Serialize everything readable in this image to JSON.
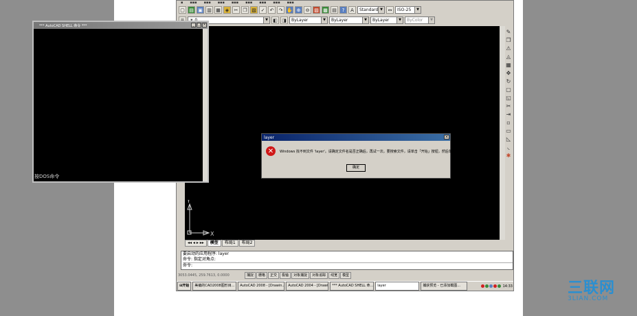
{
  "toolbar": {
    "textstyle": "Standard",
    "dimstyle": "ISO-25",
    "layer": "0",
    "color": "ByLayer",
    "linetype": "ByLayer",
    "lineweight": "ByLayer",
    "plotstyle": "ByColor"
  },
  "shell_window": {
    "title": "*** AutoCAD SHELL 命令 ***",
    "prompt": "按DOS命令"
  },
  "dialog": {
    "title": "layer",
    "message": "Windows 找不到文件 'layer'。请确定文件名是否正确后，再试一次。要搜索文件，请单击「开始」按钮，然后单击「搜索」。",
    "ok_label": "确定"
  },
  "ucs": {
    "y_label": "Y",
    "x_label": "X"
  },
  "layout_tabs": [
    "模型",
    "布局1",
    "布局2"
  ],
  "command_line": {
    "line1": "要启动的应用程序: layer",
    "line2": "命令: 指定对角点:",
    "line3": "命令:"
  },
  "status_bar": {
    "coords": "3053.0445, 259.7613, 0.0000",
    "buttons": [
      "捕捉",
      "栅格",
      "正交",
      "极轴",
      "对象捕捉",
      "对象追踪",
      "线宽",
      "模型"
    ]
  },
  "taskbar": {
    "start": "开始",
    "tasks": [
      "美编的CAD2008图形目...",
      "AutoCAD 2008 - [Drawin...",
      "AutoCAD 2004 - [Drawin...",
      "*** AutoCAD SHELL 命...",
      "layer",
      "捕获预览 - 已添加截图..."
    ],
    "clock": "14:33"
  },
  "watermark": {
    "big": "三联网",
    "small": "3LIAN.COM"
  },
  "colors": {
    "canvas": "#000000",
    "titlebar": "#0a246a",
    "error_icon": "#d01818",
    "watermark": "#2b8fd0"
  }
}
